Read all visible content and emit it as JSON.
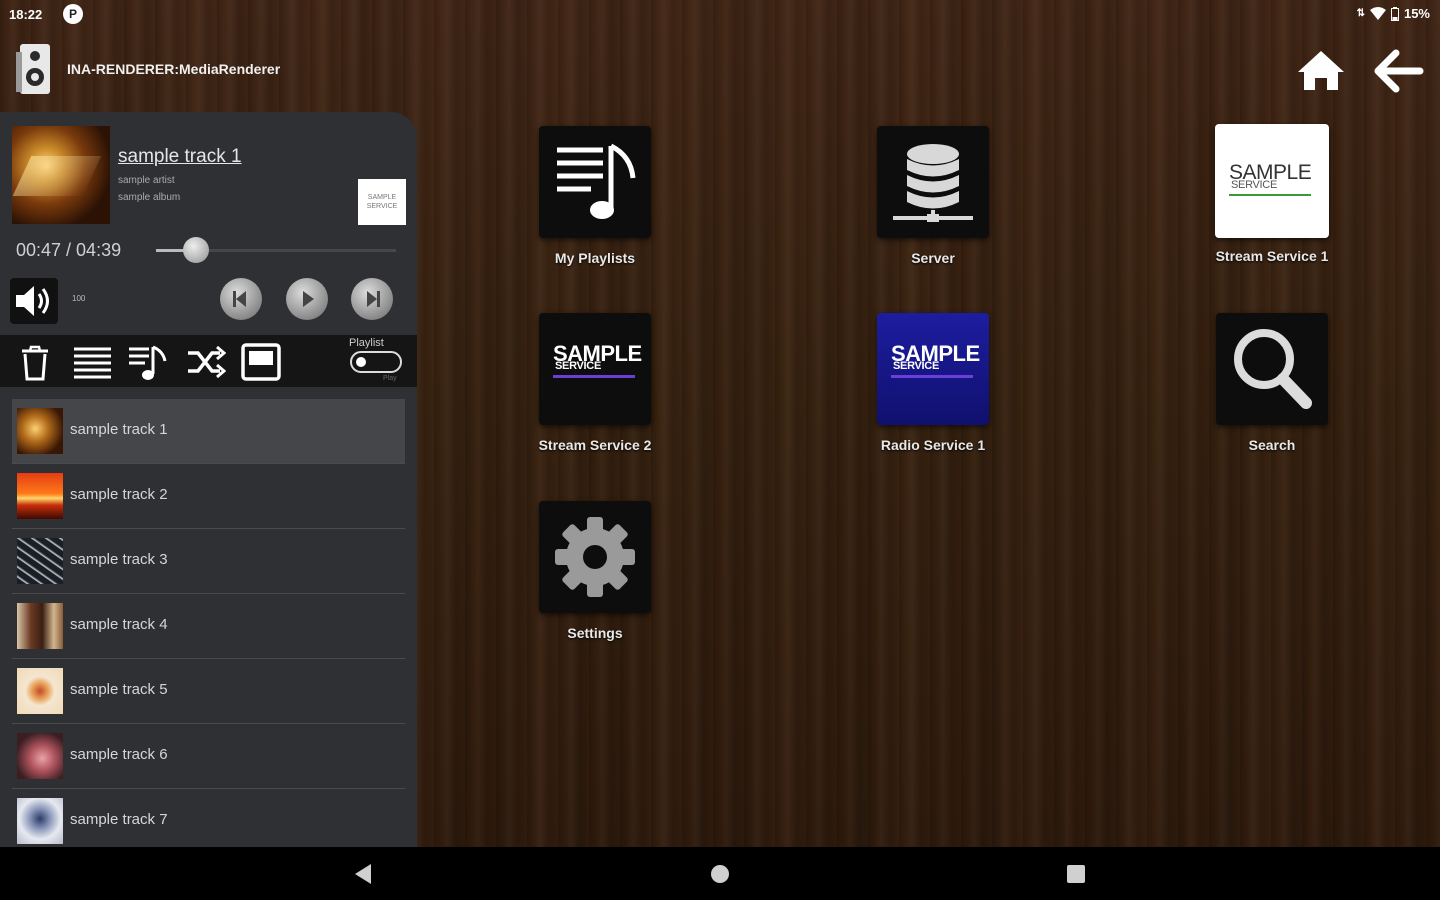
{
  "status": {
    "time": "18:22",
    "notification_icon": "P",
    "battery": "15%"
  },
  "header": {
    "renderer_name": "INA-RENDERER:MediaRenderer"
  },
  "now_playing": {
    "title": "sample track 1",
    "artist": "sample artist",
    "album": "sample album",
    "service_logo_text": "SAMPLE SERVICE",
    "time": "00:47 / 04:39",
    "progress_fraction": 0.168,
    "volume": "100"
  },
  "playlist_toggle": {
    "label": "Playlist",
    "sub_label": "Play"
  },
  "tracks": [
    {
      "label": "sample track 1"
    },
    {
      "label": "sample track 2"
    },
    {
      "label": "sample track 3"
    },
    {
      "label": "sample track 4"
    },
    {
      "label": "sample track 5"
    },
    {
      "label": "sample track 6"
    },
    {
      "label": "sample track 7"
    }
  ],
  "tiles": [
    {
      "label": "My Playlists",
      "icon": "playlist-icon"
    },
    {
      "label": "Server",
      "icon": "server-icon"
    },
    {
      "label": "Stream Service 1",
      "icon": "sample-service-logo",
      "logo_main": "SAMPLE",
      "logo_sub": "SERVICE"
    },
    {
      "label": "Stream Service 2",
      "icon": "sample-service-logo",
      "logo_main": "SAMPLE",
      "logo_sub": "SERVICE"
    },
    {
      "label": "Radio Service 1",
      "icon": "sample-service-logo",
      "logo_main": "SAMPLE",
      "logo_sub": "SERVICE"
    },
    {
      "label": "Search",
      "icon": "search-icon"
    },
    {
      "label": "Settings",
      "icon": "gear-icon"
    }
  ],
  "colors": {
    "panel": "#2f3033",
    "accent_purple": "#6a3fd8",
    "radio_blue": "#1a1a8c",
    "service_green": "#3a9a3a"
  }
}
